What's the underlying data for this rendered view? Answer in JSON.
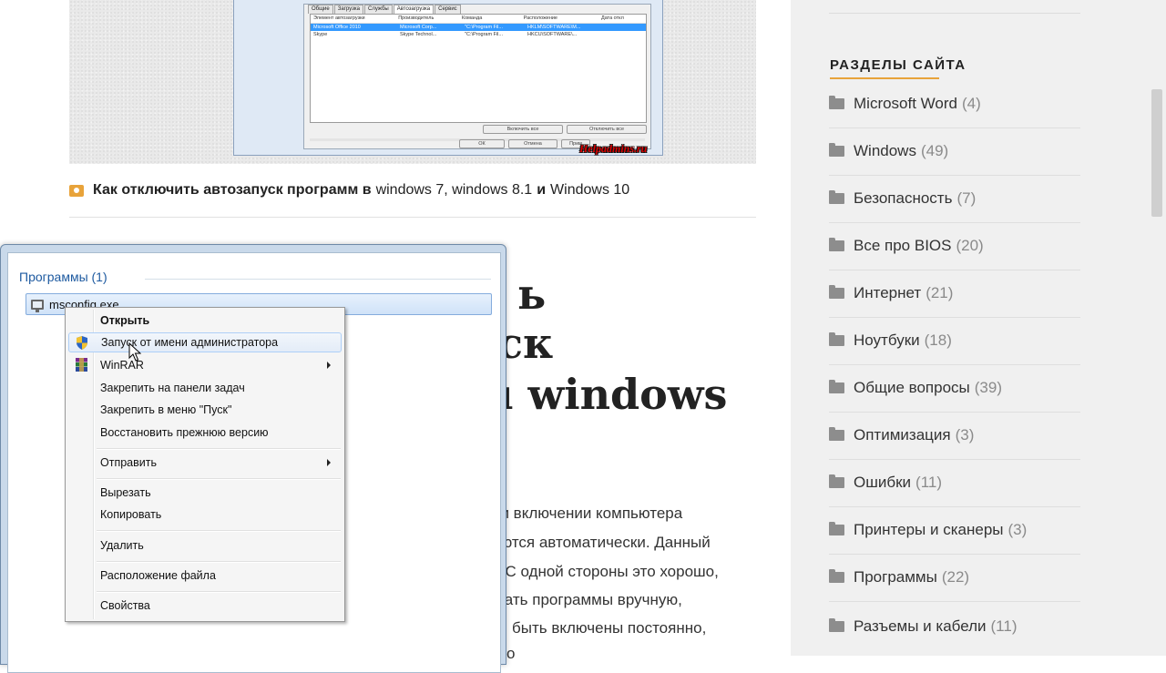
{
  "figure": {
    "dialog_tabs": [
      "Общие",
      "Загрузка",
      "Службы",
      "Автозагрузка",
      "Сервис"
    ],
    "columns": [
      "Элемент автозагрузки",
      "Производитель",
      "Команда",
      "Расположение",
      "Дата откл"
    ],
    "rows": [
      [
        "Microsoft Office 2010",
        "Microsoft Corp...",
        "\"C:\\Program Fil...",
        "HKLM\\SOFTWARE\\M...",
        ""
      ],
      [
        "Skype",
        "Skype Technol...",
        "\"C:\\Program Fil...",
        "HKCU\\SOFTWARE\\...",
        ""
      ]
    ],
    "buttons": {
      "enable_all": "Включить все",
      "disable_all": "Отключить все",
      "ok": "ОК",
      "cancel": "Отмена",
      "apply": "Прим"
    },
    "watermark": "Helpadmins.ru"
  },
  "caption": {
    "bold_part": "Как отключить автозапуск программ в",
    "normal_part": "windows 7, windows 8.1",
    "bold_and": "и",
    "normal_end": "Windows 10"
  },
  "article": {
    "heading_lines": [
      "ь",
      "ск",
      "ı windows"
    ],
    "paragraph_lines": [
      "ри включении компьютера",
      "аются автоматически. Данный",
      ". С одной стороны это хорошо,",
      "кать программы вручную,",
      "быть включены постоянно,",
      "о"
    ]
  },
  "startmenu": {
    "group_label": "Программы (1)",
    "result_label": "msconfig.exe"
  },
  "context_menu": {
    "items": [
      {
        "label": "Открыть"
      },
      {
        "label": "Запуск от имени администратора"
      },
      {
        "label": "WinRAR"
      },
      {
        "label": "Закрепить на панели задач"
      },
      {
        "label": "Закрепить в меню \"Пуск\""
      },
      {
        "label": "Восстановить прежнюю версию"
      },
      {
        "label": "Отправить"
      },
      {
        "label": "Вырезать"
      },
      {
        "label": "Копировать"
      },
      {
        "label": "Удалить"
      },
      {
        "label": "Расположение файла"
      },
      {
        "label": "Свойства"
      }
    ]
  },
  "sidebar": {
    "title": "РАЗДЕЛЫ САЙТА",
    "categories": [
      {
        "label": "Microsoft Word",
        "count": "(4)"
      },
      {
        "label": "Windows",
        "count": "(49)"
      },
      {
        "label": "Безопасность",
        "count": "(7)"
      },
      {
        "label": "Все про BIOS",
        "count": "(20)"
      },
      {
        "label": "Интернет",
        "count": "(21)"
      },
      {
        "label": "Ноутбуки",
        "count": "(18)"
      },
      {
        "label": "Общие вопросы",
        "count": "(39)"
      },
      {
        "label": "Оптимизация",
        "count": "(3)"
      },
      {
        "label": "Ошибки",
        "count": "(11)"
      },
      {
        "label": "Принтеры и сканеры",
        "count": "(3)"
      },
      {
        "label": "Программы",
        "count": "(22)"
      },
      {
        "label": "Разъемы и кабели",
        "count": "(11)"
      }
    ]
  },
  "colors": {
    "accent": "#e8a33a",
    "link_blue": "#1e5aa0",
    "selection": "#3399ff"
  }
}
